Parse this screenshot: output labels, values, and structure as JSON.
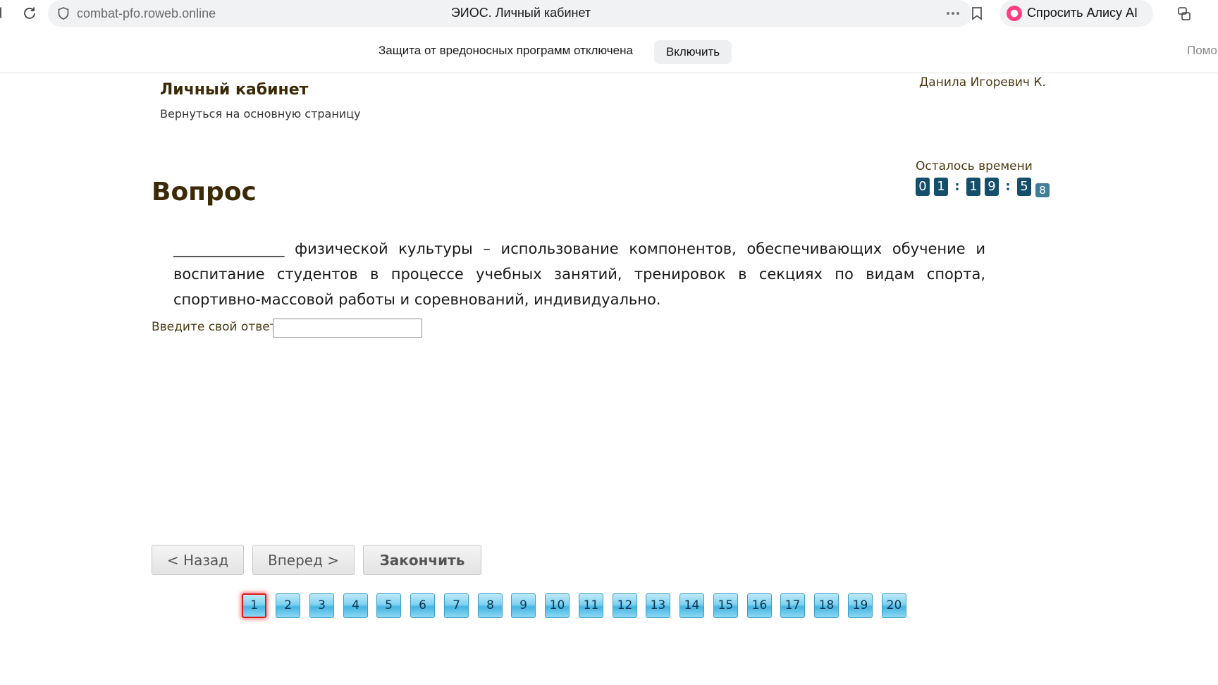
{
  "browser": {
    "url": "combat-pfo.roweb.online",
    "tab_title": "ЭИОС. Личный кабинет",
    "alice_label": "Спросить Алису AI"
  },
  "notice": {
    "text": "Защита от вредоносных программ отключена",
    "enable_label": "Включить",
    "help_label": "Помо"
  },
  "page": {
    "cabinet_title": "Личный кабинет",
    "back_link": "Вернуться на основную страницу",
    "user_name": "Данила Игоревич К."
  },
  "timer": {
    "label": "Осталось времени",
    "digits": [
      "0",
      "1",
      "1",
      "9",
      "5",
      "8"
    ]
  },
  "question": {
    "heading": "Вопрос",
    "text": "_______________ физической культуры – использование компонентов, обеспечивающих обучение и воспитание студентов в процессе учебных занятий, тренировок в секциях по видам спорта, спортивно-массовой работы и соревнований, индивидуально.",
    "answer_label": "Введите свой ответ",
    "answer_value": ""
  },
  "navigation": {
    "back_label": "< Назад",
    "forward_label": "Вперед >",
    "finish_label": "Закончить"
  },
  "pager": {
    "current": 1,
    "pages": [
      "1",
      "2",
      "3",
      "4",
      "5",
      "6",
      "7",
      "8",
      "9",
      "10",
      "11",
      "12",
      "13",
      "14",
      "15",
      "16",
      "17",
      "18",
      "19",
      "20"
    ]
  }
}
